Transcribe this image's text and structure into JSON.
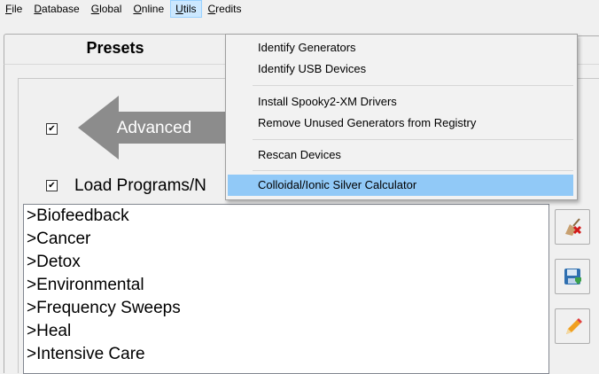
{
  "menubar": {
    "items": [
      {
        "label": "File",
        "u": "F",
        "rest": "ile"
      },
      {
        "label": "Database",
        "u": "D",
        "rest": "atabase"
      },
      {
        "label": "Global",
        "u": "G",
        "rest": "lobal"
      },
      {
        "label": "Online",
        "u": "O",
        "rest": "nline"
      },
      {
        "label": "Utils",
        "u": "U",
        "rest": "tils"
      },
      {
        "label": "Credits",
        "u": "C",
        "rest": "redits"
      }
    ],
    "open_menu": "Utils"
  },
  "tab": {
    "label": "Presets"
  },
  "advanced": {
    "label": "Advanced",
    "checked": true
  },
  "load_programs": {
    "label": "Load Programs/N",
    "checked": true
  },
  "program_list": {
    "items": [
      ">Biofeedback",
      ">Cancer",
      ">Detox",
      ">Environmental",
      ">Frequency Sweeps",
      ">Heal",
      ">Intensive Care"
    ]
  },
  "utils_menu": {
    "items": [
      {
        "label": "Identify Generators"
      },
      {
        "label": "Identify USB Devices"
      },
      {
        "label": "Install Spooky2-XM Drivers"
      },
      {
        "label": "Remove Unused Generators from Registry"
      },
      {
        "label": "Rescan Devices"
      },
      {
        "label": "Colloidal/Ionic Silver Calculator",
        "highlighted": true
      }
    ]
  },
  "side_buttons": [
    {
      "icon": "broom-clear-icon"
    },
    {
      "icon": "save-disk-icon"
    },
    {
      "icon": "pencil-edit-icon"
    }
  ],
  "colors": {
    "menu_highlight": "#91c9f7",
    "open_menu_bg": "#cce8ff",
    "arrow_gray": "#8c8c8c"
  }
}
